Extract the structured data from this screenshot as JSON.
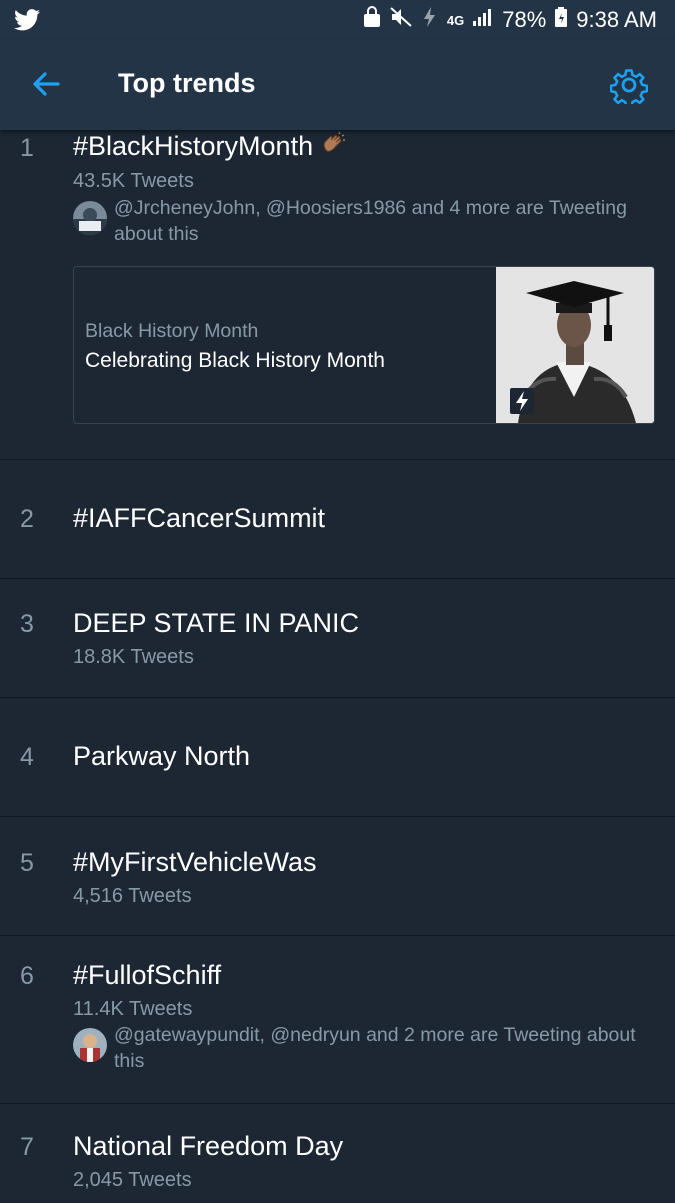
{
  "status_bar": {
    "battery": "78%",
    "time": "9:38 AM",
    "network": "4G"
  },
  "header": {
    "title": "Top trends"
  },
  "trends": [
    {
      "rank": "1",
      "name": "#BlackHistoryMonth",
      "count": "43.5K Tweets",
      "social": "@JrcheneyJohn, @Hoosiers1986 and 4 more are Tweeting about this",
      "card": {
        "topic": "Black History Month",
        "title": "Celebrating Black History Month"
      }
    },
    {
      "rank": "2",
      "name": "#IAFFCancerSummit"
    },
    {
      "rank": "3",
      "name": "DEEP STATE IN PANIC",
      "count": "18.8K Tweets"
    },
    {
      "rank": "4",
      "name": "Parkway North"
    },
    {
      "rank": "5",
      "name": "#MyFirstVehicleWas",
      "count": "4,516 Tweets"
    },
    {
      "rank": "6",
      "name": "#FullofSchiff",
      "count": "11.4K Tweets",
      "social": "@gatewaypundit, @nedryun and 2 more are Tweeting about this"
    },
    {
      "rank": "7",
      "name": "National Freedom Day",
      "count": "2,045 Tweets"
    }
  ],
  "colors": {
    "background": "#1c2733",
    "header_bg": "#243447",
    "accent": "#1da1f2",
    "secondary_text": "#8899a6"
  },
  "icons": [
    "twitter-bird-icon",
    "back-arrow-icon",
    "gear-icon",
    "lightning-icon",
    "clapping-hands-emoji"
  ]
}
